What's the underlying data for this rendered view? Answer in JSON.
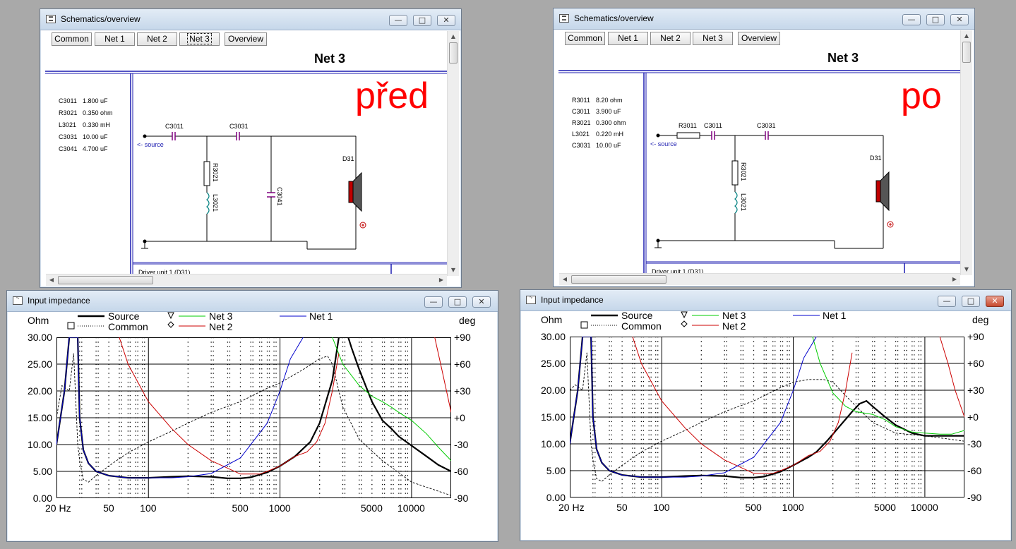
{
  "schematics": [
    {
      "title": "Schematics/overview",
      "buttons": [
        "Common",
        "Net 1",
        "Net 2",
        "Net 3",
        "Overview"
      ],
      "active_button": "Net 3",
      "page_title": "Net 3",
      "annotation": "před",
      "parts": [
        {
          "name": "C3011",
          "value": "1.800 uF"
        },
        {
          "name": "R3021",
          "value": "0.350 ohm"
        },
        {
          "name": "L3021",
          "value": "0.330 mH"
        },
        {
          "name": "C3031",
          "value": "10.00 uF"
        },
        {
          "name": "C3041",
          "value": "4.700 uF"
        }
      ],
      "circuit_labels": {
        "source": "<- source",
        "c1": "C3011",
        "c2": "C3031",
        "r": "R3021",
        "l": "L3021",
        "c3": "C3041",
        "driver": "D31"
      },
      "footer": "Driver unit 1 (D31)"
    },
    {
      "title": "Schematics/overview",
      "buttons": [
        "Common",
        "Net 1",
        "Net 2",
        "Net 3",
        "Overview"
      ],
      "active_button": "Net 3",
      "page_title": "Net 3",
      "annotation": "po",
      "parts": [
        {
          "name": "R3011",
          "value": "8.20 ohm"
        },
        {
          "name": "C3011",
          "value": "3.900 uF"
        },
        {
          "name": "R3021",
          "value": "0.300 ohm"
        },
        {
          "name": "L3021",
          "value": "0.220 mH"
        },
        {
          "name": "C3031",
          "value": "10.00 uF"
        }
      ],
      "circuit_labels": {
        "source": "<- source",
        "r0": "R3011",
        "c1": "C3011",
        "c2": "C3031",
        "r": "R3021",
        "l": "L3021",
        "driver": "D31"
      },
      "footer": "Driver unit 1 (D31)"
    }
  ],
  "impedance": [
    {
      "title": "Input impedance",
      "legend": [
        "Source",
        "Common",
        "Net 3",
        "Net 2",
        "Net 1"
      ],
      "left_unit": "Ohm",
      "right_unit": "deg"
    },
    {
      "title": "Input impedance",
      "legend": [
        "Source",
        "Common",
        "Net 3",
        "Net 2",
        "Net 1"
      ],
      "left_unit": "Ohm",
      "right_unit": "deg"
    }
  ],
  "chart_data": [
    {
      "type": "line",
      "x_scale": "log",
      "xlim": [
        20,
        20000
      ],
      "ylim": [
        0,
        30
      ],
      "y2lim": [
        -90,
        90
      ],
      "x_tick_labels": [
        "20 Hz",
        "50",
        "100",
        "500",
        "1000",
        "5000",
        "10000"
      ],
      "y_tick_labels": [
        "30.00",
        "25.00",
        "20.00",
        "15.00",
        "10.00",
        "5.00",
        "0.00"
      ],
      "y2_tick_labels": [
        "+90",
        "+60",
        "+30",
        "+0",
        "-30",
        "-60",
        "-90"
      ],
      "ylabel": "Ohm",
      "y2label": "deg",
      "grid": true,
      "series": [
        {
          "name": "Source",
          "color": "#000000",
          "style": "thick",
          "x": [
            20,
            23,
            25,
            27,
            28,
            29,
            30,
            32,
            35,
            40,
            50,
            70,
            100,
            150,
            200,
            300,
            400,
            500,
            600,
            800,
            1000,
            1300,
            1700,
            2000,
            2500,
            2800,
            3000
          ],
          "y": [
            10,
            20,
            30,
            30,
            30,
            30,
            15,
            9,
            6.5,
            5,
            4.2,
            3.8,
            3.8,
            4,
            4.1,
            4,
            3.7,
            3.7,
            3.9,
            4.8,
            6,
            7.8,
            10.5,
            14,
            22,
            30,
            30
          ]
        },
        {
          "name": "Source (2)",
          "color": "#000000",
          "style": "thick",
          "x": [
            3300,
            3500,
            4000,
            5000,
            6000,
            7000,
            8000,
            10000,
            13000,
            16000,
            20000
          ],
          "y": [
            30,
            28,
            24,
            18,
            14.5,
            13,
            11.5,
            9.8,
            7.8,
            6.2,
            5
          ]
        },
        {
          "name": "Common",
          "color": "#000000",
          "style": "dotted-phase",
          "x": [
            20,
            22,
            25,
            27,
            29,
            30,
            32,
            35,
            40,
            50,
            70,
            100,
            150,
            200,
            300,
            500,
            800,
            1000,
            1500,
            2000,
            2300,
            2500,
            2800,
            3000,
            4000,
            6000,
            10000,
            20000
          ],
          "y": [
            15,
            21,
            20,
            27,
            10,
            7,
            3.5,
            3,
            4.2,
            6,
            8.5,
            10.5,
            12.5,
            14,
            16,
            18,
            20.5,
            21.5,
            24,
            26,
            26.5,
            25,
            20,
            17,
            11,
            7,
            3,
            0.5
          ]
        },
        {
          "name": "Net 3",
          "color": "#00cc00",
          "style": "solid",
          "x": [
            2500,
            3000,
            4000,
            5000,
            6000,
            7000,
            8000,
            10000,
            13000,
            16000,
            20000
          ],
          "y": [
            30,
            25,
            21,
            19,
            18,
            17,
            16,
            14.5,
            12,
            9.5,
            7
          ]
        },
        {
          "name": "Net 2",
          "color": "#cc0000",
          "style": "solid",
          "x": [
            60,
            70,
            100,
            150,
            200,
            300,
            500,
            700,
            800,
            1000,
            1300,
            1600,
            1900,
            2200,
            2500,
            2800
          ],
          "y": [
            30,
            25,
            18,
            13,
            10,
            7,
            4.5,
            4.5,
            5,
            6,
            7.8,
            8.6,
            10.5,
            14,
            20,
            27
          ]
        },
        {
          "name": "Net 2 (2)",
          "color": "#cc0000",
          "style": "solid",
          "x": [
            15000,
            17000,
            20000
          ],
          "y": [
            30,
            24,
            16
          ]
        },
        {
          "name": "Net 1",
          "color": "#0000cc",
          "style": "solid",
          "x": [
            20,
            23,
            25,
            27,
            28,
            29,
            30,
            32,
            35,
            40,
            50,
            70,
            100,
            150,
            200,
            300,
            500,
            800,
            1000,
            1200,
            1500
          ],
          "y": [
            10,
            20,
            30,
            30,
            30,
            30,
            15,
            9,
            6.5,
            5,
            4.2,
            3.8,
            3.8,
            3.8,
            4,
            4.6,
            7.5,
            14,
            20,
            26,
            30
          ]
        }
      ]
    },
    {
      "type": "line",
      "x_scale": "log",
      "xlim": [
        20,
        20000
      ],
      "ylim": [
        0,
        30
      ],
      "y2lim": [
        -90,
        90
      ],
      "x_tick_labels": [
        "20 Hz",
        "50",
        "100",
        "500",
        "1000",
        "5000",
        "10000"
      ],
      "y_tick_labels": [
        "30.00",
        "25.00",
        "20.00",
        "15.00",
        "10.00",
        "5.00",
        "0.00"
      ],
      "y2_tick_labels": [
        "+90",
        "+60",
        "+30",
        "+0",
        "-30",
        "-60",
        "-90"
      ],
      "ylabel": "Ohm",
      "y2label": "deg",
      "grid": true,
      "series": [
        {
          "name": "Source",
          "color": "#000000",
          "style": "thick",
          "x": [
            20,
            23,
            25,
            27,
            28,
            29,
            30,
            32,
            35,
            40,
            50,
            70,
            100,
            150,
            200,
            300,
            400,
            500,
            600,
            800,
            1000,
            1300,
            1500,
            1800,
            2200,
            2800,
            3200,
            3600,
            4000,
            5000,
            6000,
            8000,
            10000,
            13000,
            20000
          ],
          "y": [
            10,
            20,
            30,
            30,
            30,
            30,
            15,
            9,
            6.5,
            5,
            4.2,
            3.8,
            3.8,
            4,
            4.1,
            4,
            3.7,
            3.7,
            3.9,
            4.8,
            6,
            7.5,
            8.5,
            10.5,
            13,
            16,
            17.5,
            18,
            17,
            15,
            13.5,
            12,
            11.5,
            11.5,
            11.5
          ]
        },
        {
          "name": "Common",
          "color": "#000000",
          "style": "dotted-phase",
          "x": [
            20,
            22,
            25,
            27,
            29,
            30,
            32,
            35,
            40,
            50,
            70,
            100,
            150,
            200,
            300,
            500,
            800,
            1000,
            1300,
            1700,
            2000,
            2500,
            3000,
            4000,
            6000,
            10000,
            20000
          ],
          "y": [
            20,
            21,
            20,
            27,
            10,
            7,
            3.5,
            3,
            4.2,
            6,
            8.5,
            10.5,
            12.5,
            14,
            16,
            18,
            20.5,
            21.5,
            22,
            22,
            21.5,
            19,
            17,
            14,
            12,
            11.5,
            10.5
          ]
        },
        {
          "name": "Net 3",
          "color": "#00cc00",
          "style": "solid",
          "x": [
            1400,
            1600,
            2000,
            2500,
            3000,
            4000,
            5000,
            6000,
            8000,
            10000,
            13000,
            16000,
            20000
          ],
          "y": [
            30,
            25,
            19.5,
            17,
            16,
            15.5,
            14.5,
            13.2,
            12.2,
            12,
            11.8,
            11.8,
            12.5
          ]
        },
        {
          "name": "Net 2",
          "color": "#cc0000",
          "style": "solid",
          "x": [
            60,
            70,
            100,
            150,
            200,
            300,
            500,
            700,
            800,
            1000,
            1300,
            1600,
            1900,
            2200,
            2500,
            2800
          ],
          "y": [
            30,
            25,
            18,
            13,
            10,
            7,
            4.5,
            4.5,
            5,
            6,
            7.8,
            8.6,
            10.5,
            14,
            20,
            27
          ]
        },
        {
          "name": "Net 2 (2)",
          "color": "#cc0000",
          "style": "solid",
          "x": [
            13000,
            15000,
            17000,
            20000
          ],
          "y": [
            30,
            25,
            20,
            15
          ]
        },
        {
          "name": "Net 1",
          "color": "#0000cc",
          "style": "solid",
          "x": [
            20,
            23,
            25,
            27,
            28,
            29,
            30,
            32,
            35,
            40,
            50,
            70,
            100,
            150,
            200,
            300,
            500,
            800,
            1000,
            1200,
            1500
          ],
          "y": [
            10,
            20,
            30,
            30,
            30,
            30,
            15,
            9,
            6.5,
            5,
            4.2,
            3.8,
            3.8,
            3.8,
            4,
            4.6,
            7.5,
            14,
            20,
            26,
            30
          ]
        }
      ]
    }
  ]
}
